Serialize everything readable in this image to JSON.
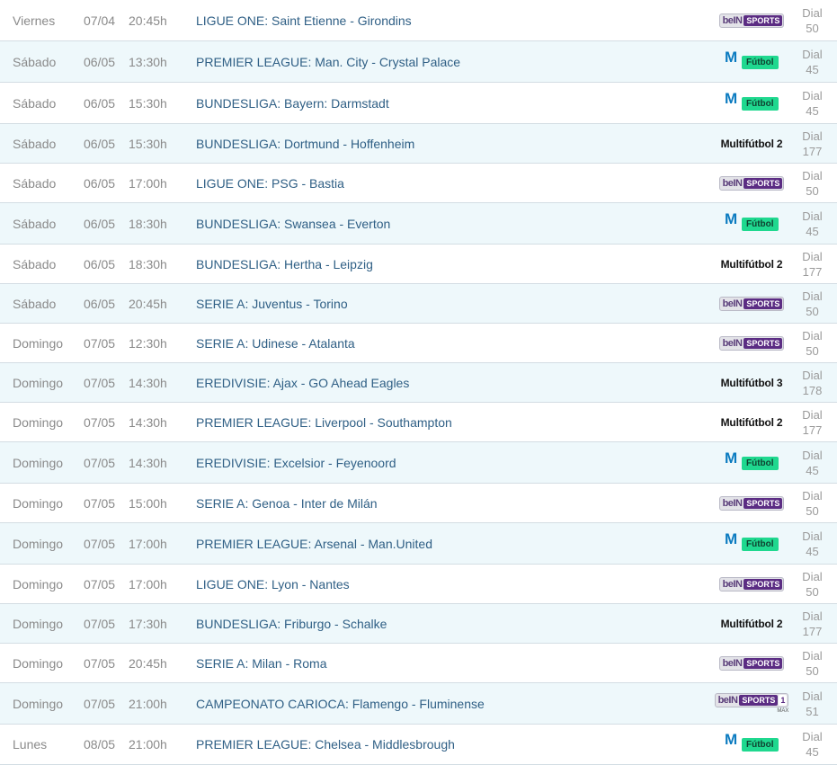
{
  "rows": [
    {
      "day": "Viernes",
      "date": "07/04",
      "time": "20:45h",
      "match": "LIGUE ONE: Saint Etienne - Girondins",
      "channel": "bein",
      "channel_label": "beIN",
      "dial_label": "Dial",
      "dial": "50"
    },
    {
      "day": "Sábado",
      "date": "06/05",
      "time": "13:30h",
      "match": "PREMIER LEAGUE: Man. City - Crystal Palace",
      "channel": "movistar",
      "channel_label": "Fútbol",
      "dial_label": "Dial",
      "dial": "45"
    },
    {
      "day": "Sábado",
      "date": "06/05",
      "time": "15:30h",
      "match": "BUNDESLIGA: Bayern: Darmstadt",
      "channel": "movistar",
      "channel_label": "Fútbol",
      "dial_label": "Dial",
      "dial": "45"
    },
    {
      "day": "Sábado",
      "date": "06/05",
      "time": "15:30h",
      "match": "BUNDESLIGA: Dortmund - Hoffenheim",
      "channel": "multi",
      "channel_label": "Multifútbol 2",
      "dial_label": "Dial",
      "dial": "177"
    },
    {
      "day": "Sábado",
      "date": "06/05",
      "time": "17:00h",
      "match": "LIGUE ONE: PSG - Bastia",
      "channel": "bein",
      "channel_label": "beIN",
      "dial_label": "Dial",
      "dial": "50"
    },
    {
      "day": "Sábado",
      "date": "06/05",
      "time": "18:30h",
      "match": "BUNDESLIGA: Swansea - Everton",
      "channel": "movistar",
      "channel_label": "Fútbol",
      "dial_label": "Dial",
      "dial": "45"
    },
    {
      "day": "Sábado",
      "date": "06/05",
      "time": "18:30h",
      "match": "BUNDESLIGA: Hertha - Leipzig",
      "channel": "multi",
      "channel_label": "Multifútbol 2",
      "dial_label": "Dial",
      "dial": "177"
    },
    {
      "day": "Sábado",
      "date": "06/05",
      "time": "20:45h",
      "match": "SERIE A: Juventus - Torino",
      "channel": "bein",
      "channel_label": "beIN",
      "dial_label": "Dial",
      "dial": "50"
    },
    {
      "day": "Domingo",
      "date": "07/05",
      "time": "12:30h",
      "match": "SERIE A: Udinese - Atalanta",
      "channel": "bein",
      "channel_label": "beIN",
      "dial_label": "Dial",
      "dial": "50"
    },
    {
      "day": "Domingo",
      "date": "07/05",
      "time": "14:30h",
      "match": "EREDIVISIE: Ajax - GO Ahead Eagles",
      "channel": "multi",
      "channel_label": "Multifútbol 3",
      "dial_label": "Dial",
      "dial": "178"
    },
    {
      "day": "Domingo",
      "date": "07/05",
      "time": "14:30h",
      "match": "PREMIER LEAGUE: Liverpool - Southampton",
      "channel": "multi",
      "channel_label": "Multifútbol 2",
      "dial_label": "Dial",
      "dial": "177"
    },
    {
      "day": "Domingo",
      "date": "07/05",
      "time": "14:30h",
      "match": "EREDIVISIE: Excelsior - Feyenoord",
      "channel": "movistar",
      "channel_label": "Fútbol",
      "dial_label": "Dial",
      "dial": "45"
    },
    {
      "day": "Domingo",
      "date": "07/05",
      "time": "15:00h",
      "match": "SERIE A: Genoa - Inter de Milán",
      "channel": "bein",
      "channel_label": "beIN",
      "dial_label": "Dial",
      "dial": "50"
    },
    {
      "day": "Domingo",
      "date": "07/05",
      "time": "17:00h",
      "match": "PREMIER LEAGUE: Arsenal - Man.United",
      "channel": "movistar",
      "channel_label": "Fútbol",
      "dial_label": "Dial",
      "dial": "45"
    },
    {
      "day": "Domingo",
      "date": "07/05",
      "time": "17:00h",
      "match": "LIGUE ONE: Lyon - Nantes",
      "channel": "bein",
      "channel_label": "beIN",
      "dial_label": "Dial",
      "dial": "50"
    },
    {
      "day": "Domingo",
      "date": "07/05",
      "time": "17:30h",
      "match": "BUNDESLIGA: Friburgo - Schalke",
      "channel": "multi",
      "channel_label": "Multifútbol 2",
      "dial_label": "Dial",
      "dial": "177"
    },
    {
      "day": "Domingo",
      "date": "07/05",
      "time": "20:45h",
      "match": "SERIE A: Milan - Roma",
      "channel": "bein",
      "channel_label": "beIN",
      "dial_label": "Dial",
      "dial": "50"
    },
    {
      "day": "Domingo",
      "date": "07/05",
      "time": "21:00h",
      "match": "CAMPEONATO CARIOCA: Flamengo - Fluminense",
      "channel": "bein1",
      "channel_label": "beIN",
      "dial_label": "Dial",
      "dial": "51"
    },
    {
      "day": "Lunes",
      "date": "08/05",
      "time": "21:00h",
      "match": "PREMIER LEAGUE: Chelsea - Middlesbrough",
      "channel": "movistar",
      "channel_label": "Fútbol",
      "dial_label": "Dial",
      "dial": "45"
    }
  ],
  "logo_text": {
    "bein_sports": "SPORTS",
    "bein_one": "1",
    "bein_mx": "MAX",
    "movistar_mark": "M"
  },
  "colors": {
    "match_text": "#2f5f85",
    "alt_row": "#eef8fb",
    "movistar_green": "#1fd88f",
    "bein_purple": "#5b2c83"
  }
}
